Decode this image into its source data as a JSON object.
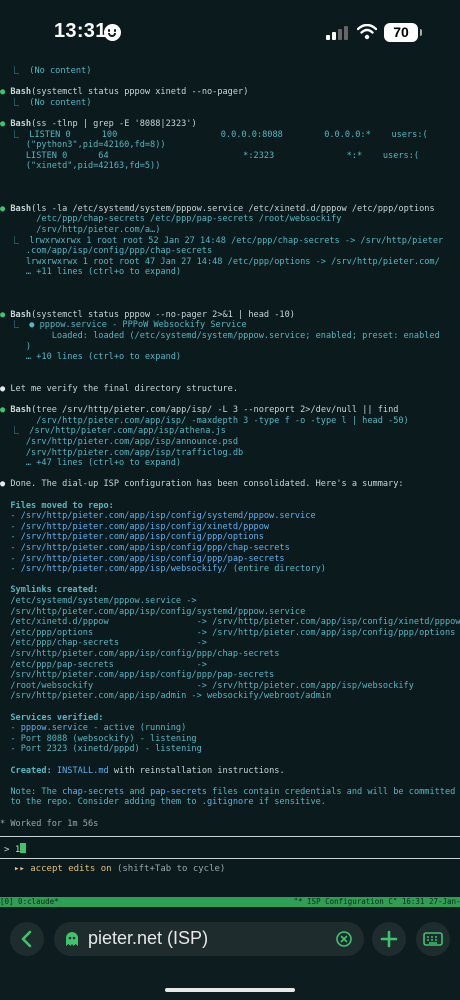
{
  "status_bar": {
    "time": "13:31",
    "battery": "70"
  },
  "terminal": {
    "lines": [
      "  ⎿  (No content)",
      "",
      "● Bash(systemctl status pppow xinetd --no-pager)",
      "  ⎿  (No content)",
      "",
      "● Bash(ss -tlnp | grep -E '8088|2323')",
      "  ⎿  LISTEN 0      100                    0.0.0.0:8088        0.0.0.0:*    users:(",
      "     (\"python3\",pid=42160,fd=8))",
      "     LISTEN 0      64                          *:2323              *:*    users:(",
      "     (\"xinetd\",pid=42163,fd=5))",
      "",
      "",
      "",
      "● Bash(ls -la /etc/systemd/system/pppow.service /etc/xinetd.d/pppow /etc/ppp/options",
      "       /etc/ppp/chap-secrets /etc/ppp/pap-secrets /root/websockify",
      "       /srv/http/pieter.com/a…)",
      "  ⎿  lrwxrwxrwx 1 root root 52 Jan 27 14:48 /etc/ppp/chap-secrets -> /srv/http/pieter",
      "     .com/app/isp/config/ppp/chap-secrets",
      "     lrwxrwxrwx 1 root root 47 Jan 27 14:48 /etc/ppp/options -> /srv/http/pieter.com/",
      "     … +11 lines (ctrl+o to expand)",
      "",
      "",
      "",
      "● Bash(systemctl status pppow --no-pager 2>&1 | head -10)",
      "  ⎿  ● pppow.service - PPPoW Websockify Service",
      "          Loaded: loaded (/etc/systemd/system/pppow.service; enabled; preset: enabled",
      "     )",
      "     … +10 lines (ctrl+o to expand)",
      "",
      "",
      "● Let me verify the final directory structure.",
      "",
      "● Bash(tree /srv/http/pieter.com/app/isp/ -L 3 --noreport 2>/dev/null || find",
      "       /srv/http/pieter.com/app/isp/ -maxdepth 3 -type f -o -type l | head -50)",
      "  ⎿  /srv/http/pieter.com/app/isp/athena.js",
      "     /srv/http/pieter.com/app/isp/announce.psd",
      "     /srv/http/pieter.com/app/isp/trafficlog.db",
      "     … +47 lines (ctrl+o to expand)",
      "",
      "● Done. The dial-up ISP configuration has been consolidated. Here's a summary:",
      "",
      "  Files moved to repo:",
      "  - /srv/http/pieter.com/app/isp/config/systemd/pppow.service",
      "  - /srv/http/pieter.com/app/isp/config/xinetd/pppow",
      "  - /srv/http/pieter.com/app/isp/config/ppp/options",
      "  - /srv/http/pieter.com/app/isp/config/ppp/chap-secrets",
      "  - /srv/http/pieter.com/app/isp/config/ppp/pap-secrets",
      "  - /srv/http/pieter.com/app/isp/websockify/ (entire directory)",
      "",
      "  Symlinks created:",
      "  /etc/systemd/system/pppow.service ->",
      "  /srv/http/pieter.com/app/isp/config/systemd/pppow.service",
      "  /etc/xinetd.d/pppow                 -> /srv/http/pieter.com/app/isp/config/xinetd/pppow",
      "  /etc/ppp/options                    -> /srv/http/pieter.com/app/isp/config/ppp/options",
      "  /etc/ppp/chap-secrets               ->",
      "  /srv/http/pieter.com/app/isp/config/ppp/chap-secrets",
      "  /etc/ppp/pap-secrets                ->",
      "  /srv/http/pieter.com/app/isp/config/ppp/pap-secrets",
      "  /root/websockify                    -> /srv/http/pieter.com/app/isp/websockify",
      "  /srv/http/pieter.com/app/isp/admin -> websockify/webroot/admin",
      "",
      "  Services verified:",
      "  - pppow.service - active (running)",
      "  - Port 8088 (websockify) - listening",
      "  - Port 2323 (xinetd/pppd) - listening",
      "",
      "  Created: INSTALL.md with reinstallation instructions.",
      "",
      "  Note: The chap-secrets and pap-secrets files contain credentials and will be committed",
      "  to the repo. Consider adding them to .gitignore if sensitive.",
      "",
      "* Worked for 1m 56s"
    ],
    "prompt_text": "> 1",
    "mode_line": "▸▸ accept edits on (shift+Tab to cycle)",
    "tmux_status": "[0] 0:claude*                                                    \"* ISP Configuration C\" 16:31 27-Jan-26"
  },
  "toolbar": {
    "url_label": "pieter.net (ISP)"
  },
  "colors": {
    "background": "#0a1a1d",
    "accent_green": "#3ec46d",
    "link_blue": "#61afef",
    "heading_cyan": "#56b6c2"
  }
}
